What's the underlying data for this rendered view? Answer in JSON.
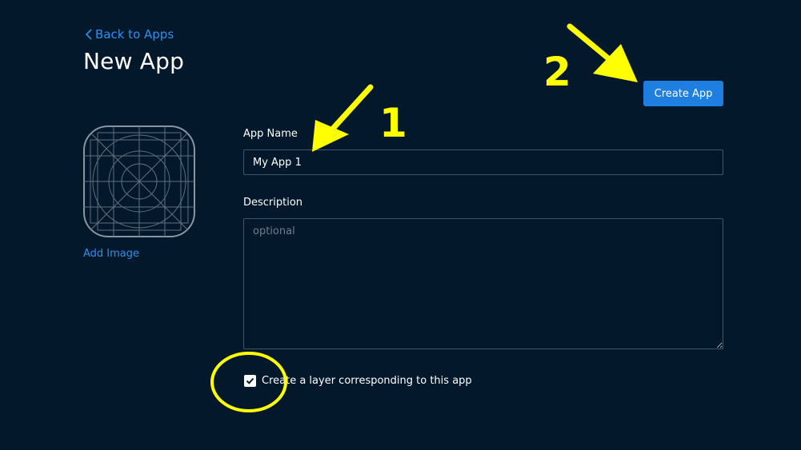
{
  "header": {
    "back_label": "Back to Apps",
    "title": "New App",
    "create_label": "Create App"
  },
  "image": {
    "add_label": "Add Image",
    "icon": "app-icon-placeholder"
  },
  "form": {
    "name_label": "App Name",
    "name_value": "My App 1",
    "description_label": "Description",
    "description_value": "",
    "description_placeholder": "optional",
    "layer_checkbox_label": "Create a layer corresponding to this app",
    "layer_checkbox_checked": true
  },
  "annotations": {
    "step_one": "1",
    "step_two": "2",
    "color": "#ffff00"
  },
  "colors": {
    "background": "#03192b",
    "accent": "#2d8ff0",
    "button": "#1e7fe0",
    "input_border": "#3f5567"
  }
}
